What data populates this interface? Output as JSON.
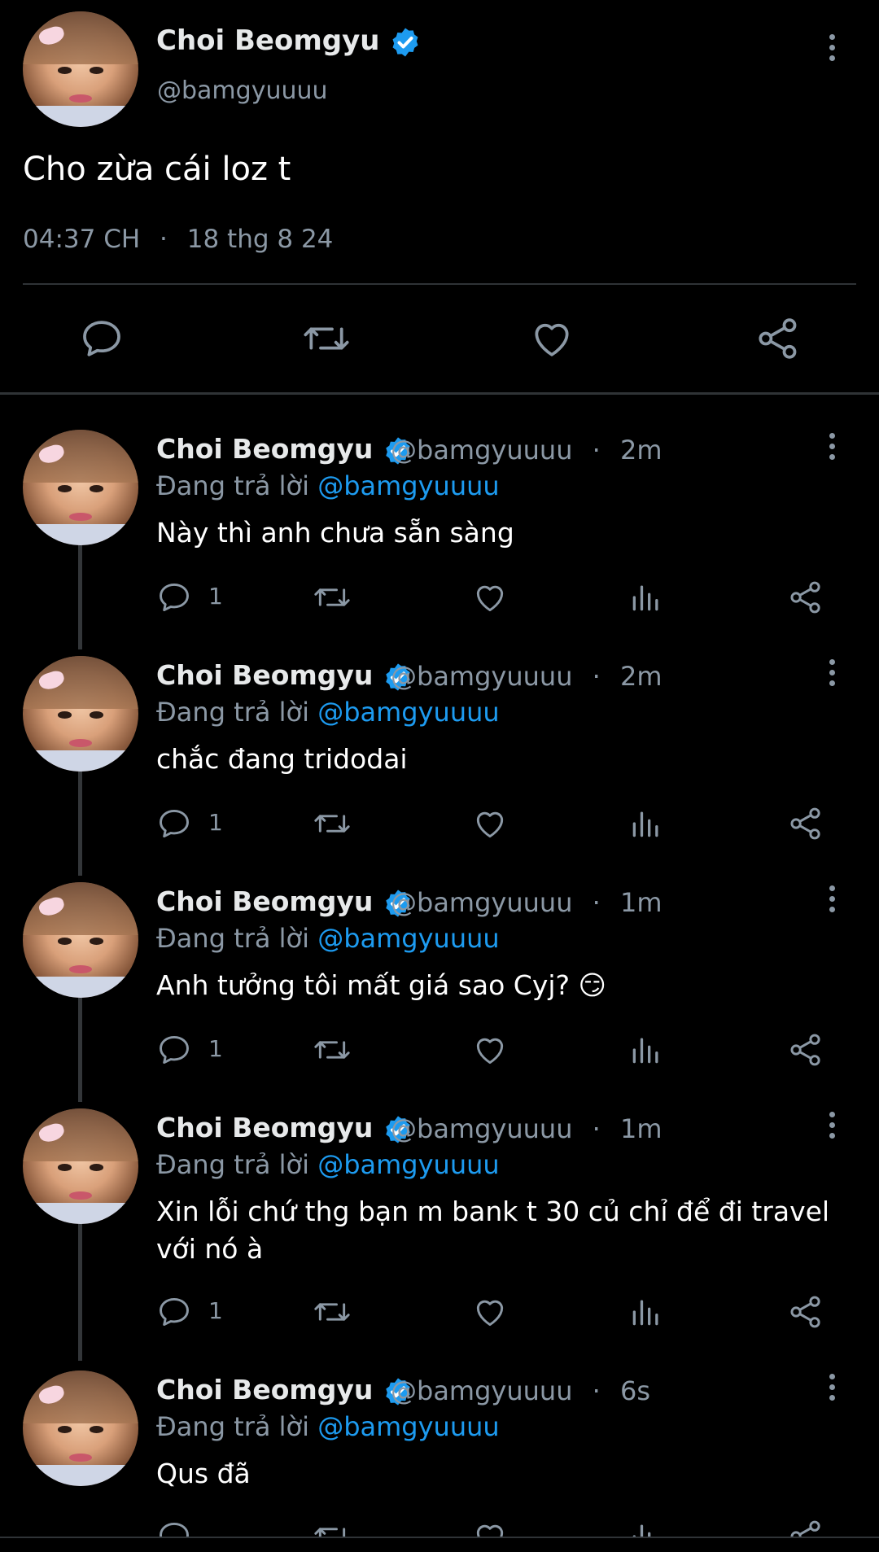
{
  "main_tweet": {
    "display_name": "Choi Beomgyu",
    "handle": "@bamgyuuuu",
    "text": "Cho zừa cái loz t",
    "time": "04:37 CH",
    "separator": "·",
    "date": "18 thg 8 24"
  },
  "replies": [
    {
      "display_name": "Choi Beomgyu",
      "handle": "@bamgyuuuu",
      "dot": "·",
      "time": "2m",
      "replying_prefix": "Đang trả lời",
      "replying_to": "@bamgyuuuu",
      "text": "Này thì anh chưa sẵn sàng",
      "reply_count": "1"
    },
    {
      "display_name": "Choi Beomgyu",
      "handle": "@bamgyuuuu",
      "dot": "·",
      "time": "2m",
      "replying_prefix": "Đang trả lời",
      "replying_to": "@bamgyuuuu",
      "text": "chắc đang tridodai",
      "reply_count": "1"
    },
    {
      "display_name": "Choi Beomgyu",
      "handle": "@bamgyuuuu",
      "dot": "·",
      "time": "1m",
      "replying_prefix": "Đang trả lời",
      "replying_to": "@bamgyuuuu",
      "text": "Anh tưởng tôi mất giá sao Cyj? 😏",
      "reply_count": "1"
    },
    {
      "display_name": "Choi Beomgyu",
      "handle": "@bamgyuuuu",
      "dot": "·",
      "time": "1m",
      "replying_prefix": "Đang trả lời",
      "replying_to": "@bamgyuuuu",
      "text": "Xin lỗi chứ thg bạn m bank t 30 củ chỉ để đi travel với nó à",
      "reply_count": "1"
    },
    {
      "display_name": "Choi Beomgyu",
      "handle": "@bamgyuuuu",
      "dot": "·",
      "time": "6s",
      "replying_prefix": "Đang trả lời",
      "replying_to": "@bamgyuuuu",
      "text": "Qus đã",
      "reply_count": ""
    }
  ],
  "icons": {
    "reply": "speech-bubble-icon",
    "retweet": "retweet-icon",
    "like": "heart-icon",
    "views": "bar-chart-icon",
    "share": "share-icon",
    "more": "vertical-dots-icon",
    "verified": "verified-badge-icon"
  },
  "colors": {
    "background": "#000000",
    "text": "#e7e9ea",
    "muted": "#8b98a5",
    "accent": "#1d9bf0"
  }
}
